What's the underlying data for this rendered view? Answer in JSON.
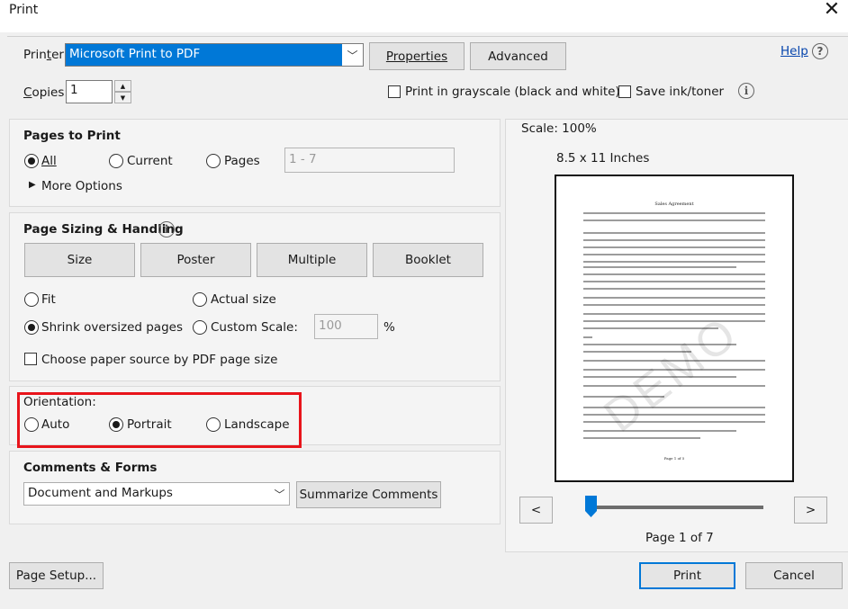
{
  "window": {
    "title": "Print",
    "close_icon": "✕"
  },
  "printer": {
    "label": "Printer:",
    "selected": "Microsoft Print to PDF",
    "properties_label": "Properties",
    "advanced_label": "Advanced",
    "help_label": "Help"
  },
  "copies": {
    "label": "Copies:",
    "value": "1"
  },
  "options": {
    "grayscale_label": "Print in grayscale (black and white)",
    "grayscale_checked": false,
    "save_ink_label": "Save ink/toner",
    "save_ink_checked": false
  },
  "pages_to_print": {
    "heading": "Pages to Print",
    "all_label": "All",
    "current_label": "Current",
    "pages_label": "Pages",
    "pages_range": "1 - 7",
    "selected": "All",
    "more_options_label": "More Options"
  },
  "page_sizing": {
    "heading": "Page Sizing & Handling",
    "tabs": [
      "Size",
      "Poster",
      "Multiple",
      "Booklet"
    ],
    "fit_label": "Fit",
    "actual_size_label": "Actual size",
    "shrink_label": "Shrink oversized pages",
    "custom_scale_label": "Custom Scale:",
    "custom_scale_value": "100",
    "percent_sign": "%",
    "selected": "Shrink oversized pages",
    "paper_source_label": "Choose paper source by PDF page size",
    "paper_source_checked": false
  },
  "orientation": {
    "heading": "Orientation:",
    "auto_label": "Auto",
    "portrait_label": "Portrait",
    "landscape_label": "Landscape",
    "selected": "Portrait",
    "highlight_color": "#e8141b"
  },
  "comments_forms": {
    "heading": "Comments & Forms",
    "selected": "Document and Markups",
    "summarize_label": "Summarize Comments"
  },
  "preview": {
    "scale_label": "Scale: 100%",
    "paper_size_label": "8.5 x 11 Inches",
    "page_indicator": "Page 1 of 7",
    "prev_label": "<",
    "next_label": ">",
    "slider_position": 0,
    "doc_title": "Sales Agreement",
    "doc_footer": "Page 1 of 5",
    "watermark": "DEMO"
  },
  "footer": {
    "page_setup_label": "Page Setup...",
    "print_label": "Print",
    "cancel_label": "Cancel"
  },
  "colors": {
    "accent": "#0078d7",
    "selection": "#0078d7",
    "link": "#0645ad"
  }
}
